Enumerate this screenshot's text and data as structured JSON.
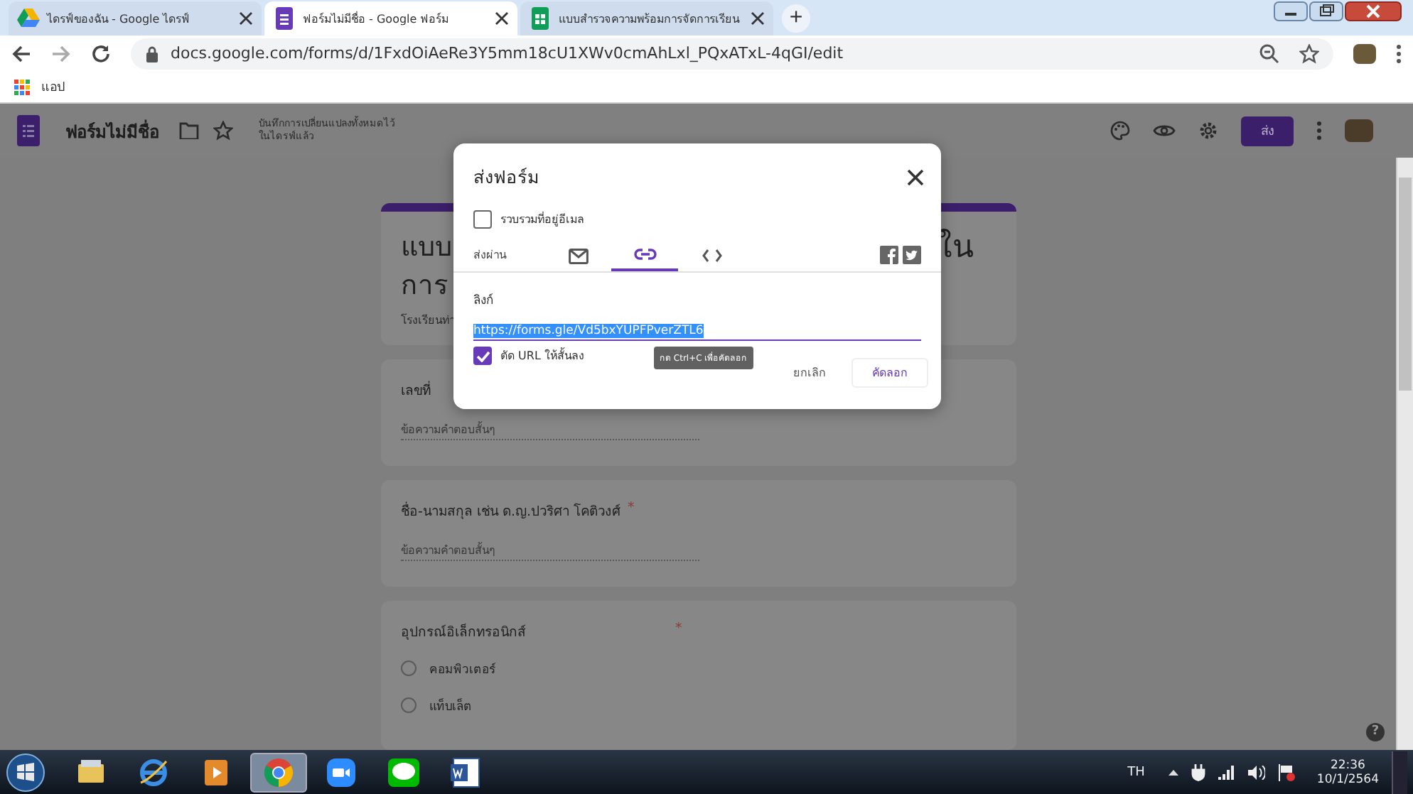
{
  "browser": {
    "tabs": [
      {
        "title": "ไดรฟ์ของฉัน - Google ไดรฟ์",
        "kind": "drive",
        "selected": false
      },
      {
        "title": "ฟอร์มไม่มีชื่อ - Google ฟอร์ม",
        "kind": "forms",
        "selected": true
      },
      {
        "title": "แบบสำรวจความพร้อมการจัดการเรียน",
        "kind": "sheets",
        "selected": false
      }
    ],
    "new_tab": "+",
    "address": "docs.google.com/forms/d/1FxdOiAeRe3Y5mm18cU1XWv0cmAhLxl_PQxATxL-4qGI/edit",
    "bookmarks": [
      {
        "label": "แอป"
      }
    ]
  },
  "app_bar": {
    "title": "ฟอร์มไม่มีชื่อ",
    "save_status": "บันทึกการเปลี่ยนแปลงทั้งหมดไว้ในไดรฟ์แล้ว",
    "send_button": "ส่ง",
    "help_button": "?"
  },
  "form": {
    "title_lines": [
      "แบบ",
      "การ"
    ],
    "title_tail": "ใน",
    "description": "โรงเรียนท่า",
    "questions": [
      {
        "kind": "short",
        "title": "เลขที่",
        "placeholder": "ข้อความคำตอบสั้นๆ"
      },
      {
        "kind": "short",
        "title": "ชื่อ-นามสกุล เช่น ด.ญ.ปวริศา โคติวงศ์",
        "required_mark": "*",
        "placeholder": "ข้อความคำตอบสั้นๆ"
      },
      {
        "kind": "choice",
        "title": "อุปกรณ์อิเล็กทรอนิกส์",
        "required_mark": "*",
        "options": [
          {
            "label": "คอมพิวเตอร์",
            "selected": false
          },
          {
            "label": "แท็บเล็ต",
            "selected": false
          }
        ]
      }
    ]
  },
  "dialog": {
    "title": "ส่งฟอร์ม",
    "collect_emails": {
      "label": "รวบรวมที่อยู่อีเมล",
      "checked": false
    },
    "send_via": "ส่งผ่าน",
    "methods": [
      {
        "kind": "email",
        "selected": false
      },
      {
        "kind": "link",
        "selected": true
      },
      {
        "kind": "embed",
        "selected": false
      }
    ],
    "link_label": "ลิงก์",
    "url": "https://forms.gle/Vd5bxYUPFPverZTL6",
    "shorten": {
      "label": "ตัด URL ให้สั้นลง",
      "checked": true
    },
    "tooltip": "กด Ctrl+C เพื่อคัดลอก",
    "cancel_button": "ยกเลิก",
    "copy_button": "คัดลอก"
  },
  "taskbar": {
    "apps": [
      {
        "kind": "explorer",
        "selected": false
      },
      {
        "kind": "ie",
        "selected": false
      },
      {
        "kind": "media",
        "selected": false
      },
      {
        "kind": "chrome",
        "selected": true
      },
      {
        "kind": "zoom",
        "selected": false
      },
      {
        "kind": "line",
        "selected": false
      },
      {
        "kind": "word",
        "selected": false
      }
    ],
    "language": "TH",
    "time": "22:36",
    "date": "10/1/2564"
  }
}
